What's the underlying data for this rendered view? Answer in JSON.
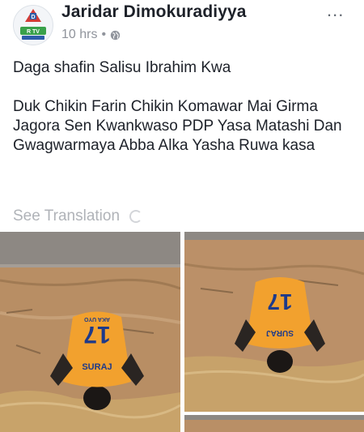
{
  "post": {
    "author": "Jaridar Dimokuradiyya",
    "time": "10 hrs",
    "separator": "•",
    "more_label": "...",
    "text_line1": "Daga shafin Salisu Ibrahim Kwa",
    "text_line2": "Duk Chikin Farin Chikin Komawar Mai Girma Jagora Sen Kwankwaso PDP Yasa Matashi Dan Gwagwarmaya Abba Alka Yasha Ruwa kasa",
    "see_translation": "See Translation"
  },
  "photos": {
    "jersey_number": "17",
    "jersey_name": "SURAJ",
    "jersey_subtext": "AKA UYO"
  },
  "colors": {
    "text": "#1d2129",
    "muted": "#90949c",
    "jersey": "#f2a12e",
    "puddle": "#c9a56a",
    "ground": "#b98f66",
    "road": "#8a8580"
  },
  "icons": [
    "avatar-logo",
    "globe-icon",
    "more-icon",
    "spinner-icon"
  ]
}
